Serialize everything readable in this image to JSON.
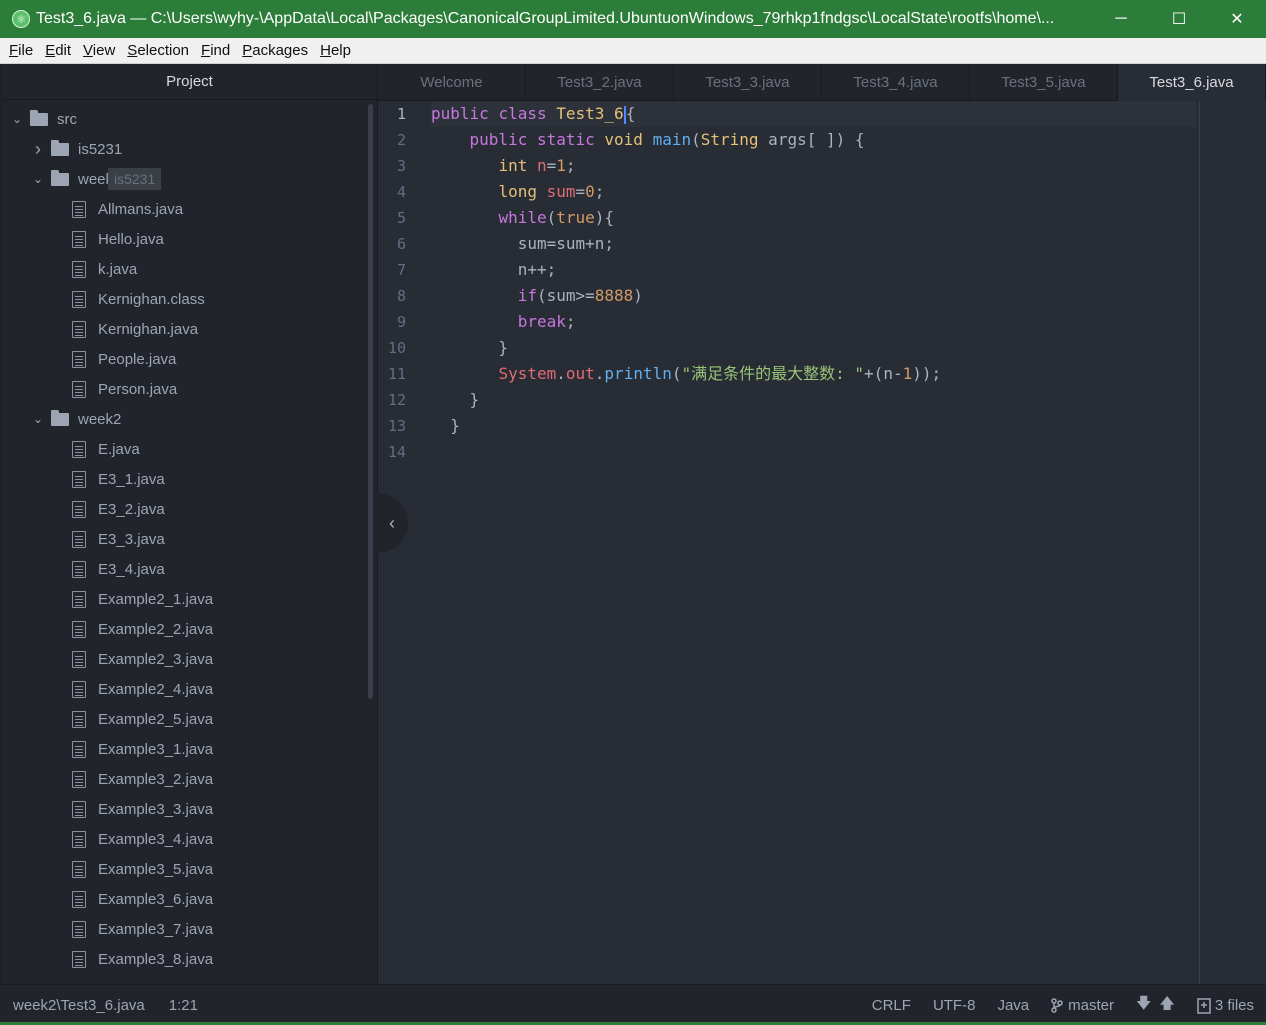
{
  "window": {
    "title": "Test3_6.java — C:\\Users\\wyhy-\\AppData\\Local\\Packages\\CanonicalGroupLimited.UbuntuonWindows_79rhkp1fndgsc\\LocalState\\rootfs\\home\\...",
    "minimize": "─",
    "maximize": "☐",
    "close": "✕"
  },
  "menu": {
    "items": [
      {
        "first": "F",
        "rest": "ile"
      },
      {
        "first": "E",
        "rest": "dit"
      },
      {
        "first": "V",
        "rest": "iew"
      },
      {
        "first": "S",
        "rest": "election"
      },
      {
        "first": "F",
        "rest": "ind"
      },
      {
        "first": "P",
        "rest": "ackages"
      },
      {
        "first": "H",
        "rest": "elp"
      }
    ]
  },
  "sidebar": {
    "title": "Project",
    "tooltip": "is5231",
    "tree": [
      {
        "label": "src",
        "type": "folder",
        "level": 0,
        "expanded": true
      },
      {
        "label": "is5231",
        "type": "folder",
        "level": 1,
        "expanded": false
      },
      {
        "label": "week1",
        "type": "folder",
        "level": 1,
        "expanded": true
      },
      {
        "label": "Allmans.java",
        "type": "file",
        "level": 2
      },
      {
        "label": "Hello.java",
        "type": "file",
        "level": 2
      },
      {
        "label": "k.java",
        "type": "file",
        "level": 2
      },
      {
        "label": "Kernighan.class",
        "type": "file",
        "level": 2
      },
      {
        "label": "Kernighan.java",
        "type": "file",
        "level": 2
      },
      {
        "label": "People.java",
        "type": "file",
        "level": 2
      },
      {
        "label": "Person.java",
        "type": "file",
        "level": 2
      },
      {
        "label": "week2",
        "type": "folder",
        "level": 1,
        "expanded": true
      },
      {
        "label": "E.java",
        "type": "file",
        "level": 2
      },
      {
        "label": "E3_1.java",
        "type": "file",
        "level": 2
      },
      {
        "label": "E3_2.java",
        "type": "file",
        "level": 2
      },
      {
        "label": "E3_3.java",
        "type": "file",
        "level": 2
      },
      {
        "label": "E3_4.java",
        "type": "file",
        "level": 2
      },
      {
        "label": "Example2_1.java",
        "type": "file",
        "level": 2
      },
      {
        "label": "Example2_2.java",
        "type": "file",
        "level": 2
      },
      {
        "label": "Example2_3.java",
        "type": "file",
        "level": 2
      },
      {
        "label": "Example2_4.java",
        "type": "file",
        "level": 2
      },
      {
        "label": "Example2_5.java",
        "type": "file",
        "level": 2
      },
      {
        "label": "Example3_1.java",
        "type": "file",
        "level": 2
      },
      {
        "label": "Example3_2.java",
        "type": "file",
        "level": 2
      },
      {
        "label": "Example3_3.java",
        "type": "file",
        "level": 2
      },
      {
        "label": "Example3_4.java",
        "type": "file",
        "level": 2
      },
      {
        "label": "Example3_5.java",
        "type": "file",
        "level": 2
      },
      {
        "label": "Example3_6.java",
        "type": "file",
        "level": 2
      },
      {
        "label": "Example3_7.java",
        "type": "file",
        "level": 2
      },
      {
        "label": "Example3_8.java",
        "type": "file",
        "level": 2
      }
    ]
  },
  "tabs": [
    {
      "label": "Welcome",
      "active": false
    },
    {
      "label": "Test3_2.java",
      "active": false
    },
    {
      "label": "Test3_3.java",
      "active": false
    },
    {
      "label": "Test3_4.java",
      "active": false
    },
    {
      "label": "Test3_5.java",
      "active": false
    },
    {
      "label": "Test3_6.java",
      "active": true
    }
  ],
  "editor": {
    "cursor_line": 1,
    "lines": [
      [
        [
          "kw",
          "public"
        ],
        [
          "pl",
          " "
        ],
        [
          "kw",
          "class"
        ],
        [
          "pl",
          " "
        ],
        [
          "ty",
          "Test3_6"
        ],
        [
          "cursor",
          ""
        ],
        [
          "pl",
          "{"
        ]
      ],
      [
        [
          "pl",
          "    "
        ],
        [
          "kw",
          "public"
        ],
        [
          "pl",
          " "
        ],
        [
          "kw",
          "static"
        ],
        [
          "pl",
          " "
        ],
        [
          "ty",
          "void"
        ],
        [
          "pl",
          " "
        ],
        [
          "fn",
          "main"
        ],
        [
          "pl",
          "("
        ],
        [
          "ty",
          "String"
        ],
        [
          "pl",
          " args[ ]) {"
        ]
      ],
      [
        [
          "pl",
          "       "
        ],
        [
          "ty",
          "int"
        ],
        [
          "pl",
          " "
        ],
        [
          "vr",
          "n"
        ],
        [
          "pl",
          "="
        ],
        [
          "nm",
          "1"
        ],
        [
          "pl",
          ";"
        ]
      ],
      [
        [
          "pl",
          "       "
        ],
        [
          "ty",
          "long"
        ],
        [
          "pl",
          " "
        ],
        [
          "vr",
          "sum"
        ],
        [
          "pl",
          "="
        ],
        [
          "nm",
          "0"
        ],
        [
          "pl",
          ";"
        ]
      ],
      [
        [
          "pl",
          "       "
        ],
        [
          "kw",
          "while"
        ],
        [
          "pl",
          "("
        ],
        [
          "nm",
          "true"
        ],
        [
          "pl",
          "){"
        ]
      ],
      [
        [
          "pl",
          "         sum=sum+n;"
        ]
      ],
      [
        [
          "pl",
          "         n++;"
        ]
      ],
      [
        [
          "pl",
          "         "
        ],
        [
          "kw",
          "if"
        ],
        [
          "pl",
          "(sum>="
        ],
        [
          "nm",
          "8888"
        ],
        [
          "pl",
          ")"
        ]
      ],
      [
        [
          "pl",
          "         "
        ],
        [
          "kw",
          "break"
        ],
        [
          "pl",
          ";"
        ]
      ],
      [
        [
          "pl",
          "       }"
        ]
      ],
      [
        [
          "pl",
          "       "
        ],
        [
          "vr",
          "System"
        ],
        [
          "pl",
          "."
        ],
        [
          "vr",
          "out"
        ],
        [
          "pl",
          "."
        ],
        [
          "fn",
          "println"
        ],
        [
          "pl",
          "("
        ],
        [
          "st",
          "\"满足条件的最大整数: \""
        ],
        [
          "pl",
          "+(n-"
        ],
        [
          "nm",
          "1"
        ],
        [
          "pl",
          "));"
        ]
      ],
      [
        [
          "pl",
          "    }"
        ]
      ],
      [
        [
          "pl",
          "  }"
        ]
      ],
      []
    ]
  },
  "status": {
    "file_path": "week2\\Test3_6.java",
    "cursor_pos": "1:21",
    "line_ending": "CRLF",
    "encoding": "UTF-8",
    "grammar": "Java",
    "branch": "master",
    "files_label": "3 files"
  },
  "colors": {
    "titlebar": "#2d7d3a",
    "editor_bg": "#282c34",
    "sidebar_bg": "#21252b",
    "keyword": "#c678dd",
    "type": "#e5c07b",
    "function": "#61afef",
    "number": "#d19a66",
    "variable": "#e06c75",
    "string": "#98c379"
  }
}
